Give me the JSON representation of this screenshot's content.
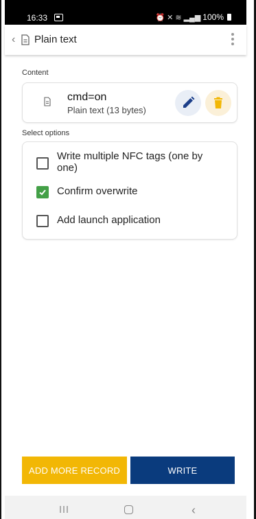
{
  "status_bar": {
    "time": "16:33",
    "battery": "100%"
  },
  "app_bar": {
    "title": "Plain text"
  },
  "content_section": {
    "label": "Content",
    "record": {
      "title": "cmd=on",
      "subtitle": "Plain text (13 bytes)"
    }
  },
  "options_section": {
    "label": "Select options",
    "items": [
      {
        "label_line1": "Write multiple NFC tags (one by",
        "label_line2": "one)",
        "checked": false
      },
      {
        "label": "Confirm overwrite",
        "checked": true
      },
      {
        "label": "Add launch application",
        "checked": false
      }
    ]
  },
  "buttons": {
    "add_more": "ADD MORE RECORD",
    "write": "WRITE"
  },
  "colors": {
    "accent_yellow": "#f2b705",
    "primary_blue": "#0a3b7d",
    "check_green": "#43a047",
    "edit_icon": "#1d3f8a",
    "delete_icon": "#f2b705"
  },
  "icons": [
    "back-icon",
    "document-icon",
    "overflow-menu-icon",
    "pencil-icon",
    "trash-icon",
    "recents-icon",
    "home-icon",
    "back-nav-icon"
  ]
}
